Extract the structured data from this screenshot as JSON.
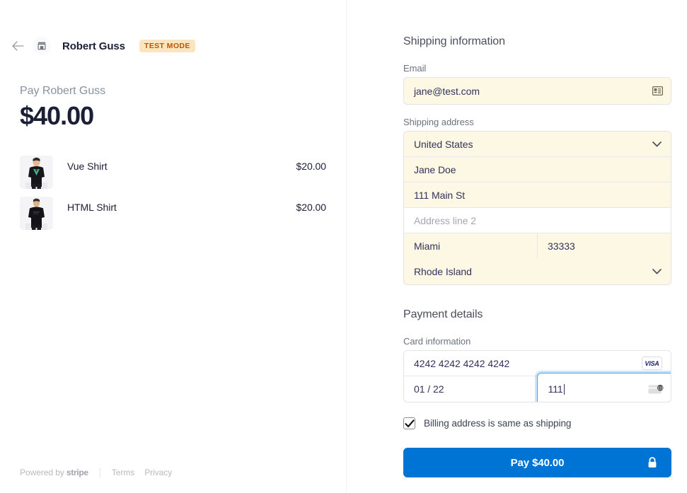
{
  "merchant": {
    "name": "Robert Guss",
    "test_mode_badge": "TEST MODE",
    "back_icon": "back-arrow-icon",
    "avatar_icon": "storefront-icon"
  },
  "summary": {
    "pay_label": "Pay Robert Guss",
    "amount": "$40.00",
    "items": [
      {
        "name": "Vue Shirt",
        "price": "$20.00",
        "thumb": "vue-shirt-photo"
      },
      {
        "name": "HTML Shirt",
        "price": "$20.00",
        "thumb": "html-shirt-photo"
      }
    ]
  },
  "footer": {
    "powered_by": "Powered by",
    "stripe": "stripe",
    "terms": "Terms",
    "privacy": "Privacy"
  },
  "shipping": {
    "section_title": "Shipping information",
    "email_label": "Email",
    "email_value": "jane@test.com",
    "email_icon": "contact-card-icon",
    "address_label": "Shipping address",
    "country_value": "United States",
    "name_value": "Jane Doe",
    "address1_value": "111 Main St",
    "address2_placeholder": "Address line 2",
    "address2_value": "",
    "city_value": "Miami",
    "zip_value": "33333",
    "state_value": "Rhode Island",
    "chevron_icon": "chevron-down-icon"
  },
  "payment": {
    "section_title": "Payment details",
    "card_label": "Card information",
    "card_number": "4242 4242 4242 4242",
    "card_brand": "VISA",
    "expiry": "01 / 22",
    "cvc": "111",
    "cvc_icon": "cvc-card-icon",
    "billing_checkbox_label": "Billing address is same as shipping",
    "billing_checkbox_checked": true,
    "pay_button_label": "Pay $40.00",
    "lock_icon": "lock-icon"
  },
  "colors": {
    "accent_blue": "#0074d4",
    "focus_blue": "#4d9fe8",
    "autofill_yellow": "#fcf8e3",
    "badge_bg": "#fbe5bf",
    "badge_text": "#bb5504",
    "visa_navy": "#1a1f71"
  }
}
